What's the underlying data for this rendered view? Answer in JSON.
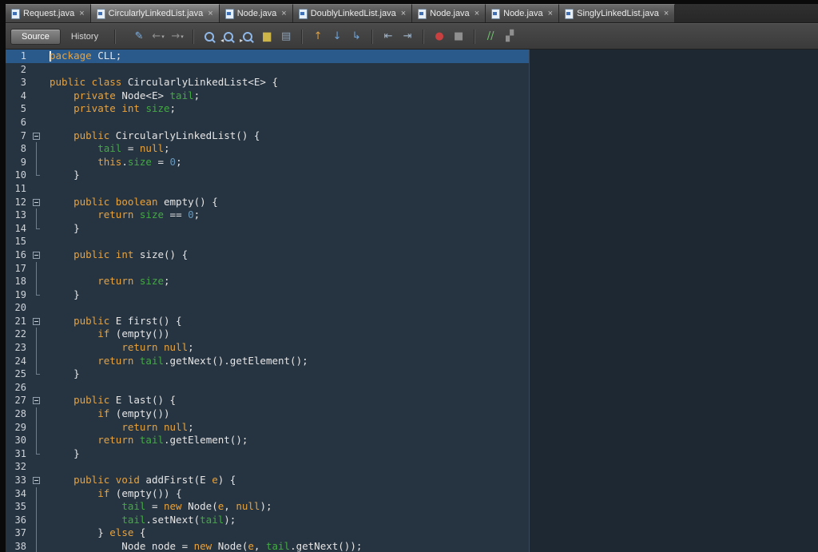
{
  "tabs": [
    {
      "label": "Request.java",
      "active": false
    },
    {
      "label": "CircularlyLinkedList.java",
      "active": true
    },
    {
      "label": "Node.java",
      "active": false
    },
    {
      "label": "DoublyLinkedList.java",
      "active": false
    },
    {
      "label": "Node.java",
      "active": false
    },
    {
      "label": "Node.java",
      "active": false
    },
    {
      "label": "SinglyLinkedList.java",
      "active": false
    }
  ],
  "toolbar": {
    "source_label": "Source",
    "history_label": "History",
    "groups": [
      [
        {
          "name": "last-edit-icon",
          "glyph": "✎",
          "color": "#7fb2e5"
        },
        {
          "name": "back-icon",
          "glyph": "←",
          "color": "#8f8f8f",
          "dropdown": true
        },
        {
          "name": "forward-icon",
          "glyph": "→",
          "color": "#8f8f8f",
          "dropdown": true
        }
      ],
      [
        {
          "name": "find-selection-icon",
          "kind": "mag"
        },
        {
          "name": "find-previous-icon",
          "kind": "mag",
          "badge": "◂"
        },
        {
          "name": "find-next-icon",
          "kind": "mag",
          "badge": "▸"
        },
        {
          "name": "toggle-highlight-icon",
          "glyph": "▆",
          "color": "#cdb54a"
        },
        {
          "name": "select-text-icon",
          "glyph": "▤",
          "color": "#8fa3b8"
        }
      ],
      [
        {
          "name": "previous-occurrence-icon",
          "glyph": "↑",
          "color": "#d9a04a"
        },
        {
          "name": "next-occurrence-icon",
          "glyph": "↓",
          "color": "#6fa3d8"
        },
        {
          "name": "go-to-line-icon",
          "glyph": "↳",
          "color": "#6fa3d8"
        }
      ],
      [
        {
          "name": "shift-left-icon",
          "glyph": "⇤",
          "color": "#9fb3c8"
        },
        {
          "name": "shift-right-icon",
          "glyph": "⇥",
          "color": "#9fb3c8"
        }
      ],
      [
        {
          "name": "record-macro-icon",
          "glyph": "●",
          "color": "#c94040"
        },
        {
          "name": "stop-macro-icon",
          "glyph": "■",
          "color": "#8f8f8f"
        }
      ],
      [
        {
          "name": "comment-icon",
          "glyph": "//",
          "color": "#6fbf6f"
        },
        {
          "name": "uncomment-icon",
          "glyph": "▞",
          "color": "#8f8f8f"
        }
      ]
    ]
  },
  "editor": {
    "lines": [
      {
        "n": 1,
        "cur": true,
        "t": [
          [
            "kw",
            "package"
          ],
          [
            "pl",
            " CLL;"
          ]
        ]
      },
      {
        "n": 2,
        "t": []
      },
      {
        "n": 3,
        "t": [
          [
            "kw",
            "public class"
          ],
          [
            "pl",
            " CircularlyLinkedList<E> {"
          ]
        ]
      },
      {
        "n": 4,
        "t": [
          [
            "pl",
            "    "
          ],
          [
            "kw",
            "private"
          ],
          [
            "pl",
            " Node<E> "
          ],
          [
            "fld",
            "tail"
          ],
          [
            "pl",
            ";"
          ]
        ]
      },
      {
        "n": 5,
        "t": [
          [
            "pl",
            "    "
          ],
          [
            "kw",
            "private int"
          ],
          [
            "pl",
            " "
          ],
          [
            "fld",
            "size"
          ],
          [
            "pl",
            ";"
          ]
        ]
      },
      {
        "n": 6,
        "t": []
      },
      {
        "n": 7,
        "fold": "start",
        "t": [
          [
            "pl",
            "    "
          ],
          [
            "kw",
            "public"
          ],
          [
            "pl",
            " CircularlyLinkedList() {"
          ]
        ]
      },
      {
        "n": 8,
        "fold": "mid",
        "t": [
          [
            "pl",
            "        "
          ],
          [
            "fld",
            "tail"
          ],
          [
            "pl",
            " = "
          ],
          [
            "kw",
            "null"
          ],
          [
            "pl",
            ";"
          ]
        ]
      },
      {
        "n": 9,
        "fold": "mid",
        "t": [
          [
            "pl",
            "        "
          ],
          [
            "kw",
            "this"
          ],
          [
            "pl",
            "."
          ],
          [
            "fld",
            "size"
          ],
          [
            "pl",
            " = "
          ],
          [
            "num",
            "0"
          ],
          [
            "pl",
            ";"
          ]
        ]
      },
      {
        "n": 10,
        "fold": "end",
        "t": [
          [
            "pl",
            "    }"
          ]
        ]
      },
      {
        "n": 11,
        "t": []
      },
      {
        "n": 12,
        "fold": "start",
        "t": [
          [
            "pl",
            "    "
          ],
          [
            "kw",
            "public boolean"
          ],
          [
            "pl",
            " empty() {"
          ]
        ]
      },
      {
        "n": 13,
        "fold": "mid",
        "t": [
          [
            "pl",
            "        "
          ],
          [
            "kw",
            "return"
          ],
          [
            "pl",
            " "
          ],
          [
            "fld",
            "size"
          ],
          [
            "pl",
            " == "
          ],
          [
            "num",
            "0"
          ],
          [
            "pl",
            ";"
          ]
        ]
      },
      {
        "n": 14,
        "fold": "end",
        "t": [
          [
            "pl",
            "    }"
          ]
        ]
      },
      {
        "n": 15,
        "t": []
      },
      {
        "n": 16,
        "fold": "start",
        "t": [
          [
            "pl",
            "    "
          ],
          [
            "kw",
            "public int"
          ],
          [
            "pl",
            " size() {"
          ]
        ]
      },
      {
        "n": 17,
        "fold": "mid",
        "t": []
      },
      {
        "n": 18,
        "fold": "mid",
        "t": [
          [
            "pl",
            "        "
          ],
          [
            "kw",
            "return"
          ],
          [
            "pl",
            " "
          ],
          [
            "fld",
            "size"
          ],
          [
            "pl",
            ";"
          ]
        ]
      },
      {
        "n": 19,
        "fold": "end",
        "t": [
          [
            "pl",
            "    }"
          ]
        ]
      },
      {
        "n": 20,
        "t": []
      },
      {
        "n": 21,
        "fold": "start",
        "t": [
          [
            "pl",
            "    "
          ],
          [
            "kw",
            "public"
          ],
          [
            "pl",
            " E first() {"
          ]
        ]
      },
      {
        "n": 22,
        "fold": "mid",
        "t": [
          [
            "pl",
            "        "
          ],
          [
            "kw",
            "if"
          ],
          [
            "pl",
            " (empty())"
          ]
        ]
      },
      {
        "n": 23,
        "fold": "mid",
        "t": [
          [
            "pl",
            "            "
          ],
          [
            "kw",
            "return null"
          ],
          [
            "pl",
            ";"
          ]
        ]
      },
      {
        "n": 24,
        "fold": "mid",
        "t": [
          [
            "pl",
            "        "
          ],
          [
            "kw",
            "return"
          ],
          [
            "pl",
            " "
          ],
          [
            "fld",
            "tail"
          ],
          [
            "pl",
            ".getNext().getElement();"
          ]
        ]
      },
      {
        "n": 25,
        "fold": "end",
        "t": [
          [
            "pl",
            "    }"
          ]
        ]
      },
      {
        "n": 26,
        "t": []
      },
      {
        "n": 27,
        "fold": "start",
        "t": [
          [
            "pl",
            "    "
          ],
          [
            "kw",
            "public"
          ],
          [
            "pl",
            " E last() {"
          ]
        ]
      },
      {
        "n": 28,
        "fold": "mid",
        "t": [
          [
            "pl",
            "        "
          ],
          [
            "kw",
            "if"
          ],
          [
            "pl",
            " (empty())"
          ]
        ]
      },
      {
        "n": 29,
        "fold": "mid",
        "t": [
          [
            "pl",
            "            "
          ],
          [
            "kw",
            "return null"
          ],
          [
            "pl",
            ";"
          ]
        ]
      },
      {
        "n": 30,
        "fold": "mid",
        "t": [
          [
            "pl",
            "        "
          ],
          [
            "kw",
            "return"
          ],
          [
            "pl",
            " "
          ],
          [
            "fld",
            "tail"
          ],
          [
            "pl",
            ".getElement();"
          ]
        ]
      },
      {
        "n": 31,
        "fold": "end",
        "t": [
          [
            "pl",
            "    }"
          ]
        ]
      },
      {
        "n": 32,
        "t": []
      },
      {
        "n": 33,
        "fold": "start",
        "t": [
          [
            "pl",
            "    "
          ],
          [
            "kw",
            "public void"
          ],
          [
            "pl",
            " addFirst(E "
          ],
          [
            "prm",
            "e"
          ],
          [
            "pl",
            ") {"
          ]
        ]
      },
      {
        "n": 34,
        "fold": "mid",
        "t": [
          [
            "pl",
            "        "
          ],
          [
            "kw",
            "if"
          ],
          [
            "pl",
            " (empty()) {"
          ]
        ]
      },
      {
        "n": 35,
        "fold": "mid",
        "t": [
          [
            "pl",
            "            "
          ],
          [
            "fld",
            "tail"
          ],
          [
            "pl",
            " = "
          ],
          [
            "kw",
            "new"
          ],
          [
            "pl",
            " Node("
          ],
          [
            "prm",
            "e"
          ],
          [
            "pl",
            ", "
          ],
          [
            "kw",
            "null"
          ],
          [
            "pl",
            ");"
          ]
        ]
      },
      {
        "n": 36,
        "fold": "mid",
        "t": [
          [
            "pl",
            "            "
          ],
          [
            "fld",
            "tail"
          ],
          [
            "pl",
            ".setNext("
          ],
          [
            "fld",
            "tail"
          ],
          [
            "pl",
            ");"
          ]
        ]
      },
      {
        "n": 37,
        "fold": "mid",
        "t": [
          [
            "pl",
            "        } "
          ],
          [
            "kw",
            "else"
          ],
          [
            "pl",
            " {"
          ]
        ]
      },
      {
        "n": 38,
        "fold": "mid",
        "t": [
          [
            "pl",
            "            Node node = "
          ],
          [
            "kw",
            "new"
          ],
          [
            "pl",
            " Node("
          ],
          [
            "prm",
            "e"
          ],
          [
            "pl",
            ", "
          ],
          [
            "fld",
            "tail"
          ],
          [
            "pl",
            ".getNext());"
          ]
        ]
      }
    ]
  },
  "colors": {
    "keyword": "#e8a33d",
    "field": "#44aa44",
    "number": "#6897bb",
    "plain": "#e6e6e6",
    "current_line": "#2a5a8c",
    "editor_bg": "#263340"
  }
}
